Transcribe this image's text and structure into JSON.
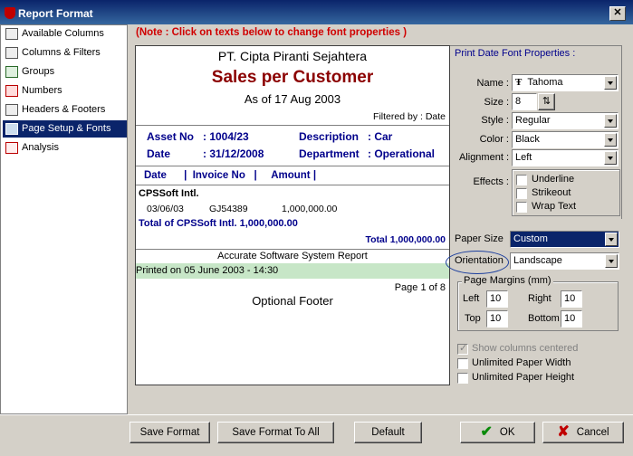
{
  "window": {
    "title": "Report Format",
    "close_glyph": "✕"
  },
  "sidebar": {
    "items": [
      {
        "label": "Available Columns"
      },
      {
        "label": "Columns & Filters"
      },
      {
        "label": "Groups"
      },
      {
        "label": "Numbers"
      },
      {
        "label": "Headers & Footers"
      },
      {
        "label": "Page Setup & Fonts"
      },
      {
        "label": "Analysis"
      }
    ],
    "selected": "Page Setup & Fonts"
  },
  "note": "(Note : Click on texts below to change font properties )",
  "preview": {
    "company": "PT. Cipta Piranti Sejahtera",
    "title": "Sales per Customer",
    "as_of": "As of 17 Aug 2003",
    "filtered_by": "Filtered by : Date",
    "asset_no_label": "Asset No",
    "asset_no_value": ": 1004/23",
    "description_label": "Description",
    "description_value": ": Car",
    "date_label": "Date",
    "date_value": ": 31/12/2008",
    "department_label": "Department",
    "department_value": ": Operational",
    "columns_header": "Date      |  Invoice No   |     Amount |",
    "customer": "CPSSoft Intl.",
    "row_date": "03/06/03",
    "row_invoice": "GJ54389",
    "row_amount": "1,000,000.00",
    "group_total": "Total of CPSSoft Intl. 1,000,000.00",
    "grand_total": "Total 1,000,000.00",
    "report_footer": "Accurate Software System Report",
    "printed_on": "Printed on 05 June 2003 - 14:30",
    "page_of": "Page 1 of 8",
    "optional_footer": "Optional Footer"
  },
  "font_props": {
    "title": "Print Date Font Properties :",
    "name_label": "Name :",
    "name_value": "Tahoma",
    "name_icon_glyph": "Ŧ",
    "size_label": "Size :",
    "size_value": "8",
    "size_icon_glyph": "⇅",
    "style_label": "Style :",
    "style_value": "Regular",
    "color_label": "Color :",
    "color_value": "Black",
    "alignment_label": "Alignment :",
    "alignment_value": "Left",
    "effects_label": "Effects :",
    "underline_label": "Underline",
    "strikeout_label": "Strikeout",
    "wrap_label": "Wrap Text"
  },
  "page_setup": {
    "paper_size_label": "Paper Size",
    "paper_size_value": "Custom",
    "orientation_label": "Orientation",
    "orientation_value": "Landscape",
    "margins_title": "Page Margins (mm)",
    "left_label": "Left",
    "left_value": "10",
    "right_label": "Right",
    "right_value": "10",
    "top_label": "Top",
    "top_value": "10",
    "bottom_label": "Bottom",
    "bottom_value": "10",
    "show_centered_label": "Show columns centered",
    "unlimited_width_label": "Unlimited Paper Width",
    "unlimited_height_label": "Unlimited Paper Height"
  },
  "buttons": {
    "save_format": "Save Format",
    "save_format_all": "Save Format To All",
    "default": "Default",
    "ok": "OK",
    "ok_glyph": "✔",
    "cancel": "Cancel",
    "cancel_glyph": "✘"
  },
  "colors": {
    "accent": "#0a246a",
    "note_red": "#d00000",
    "title_red": "#8b0000",
    "label_blue": "#00008b",
    "ok_green": "#0a8a0a",
    "cancel_red": "#c00000"
  }
}
